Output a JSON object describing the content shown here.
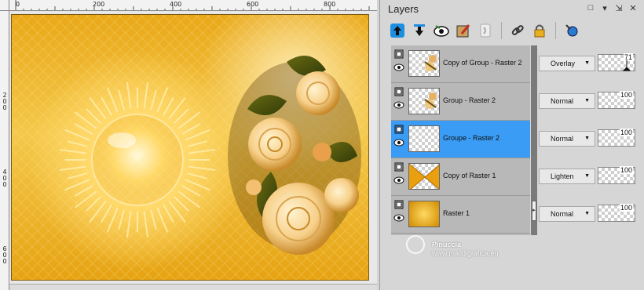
{
  "rulers": {
    "top_labels": [
      "0",
      "200",
      "400",
      "600",
      "800"
    ],
    "left_labels": [
      "2\n0\n0",
      "4\n0\n0",
      "6\n0\n0"
    ]
  },
  "palette": {
    "title": "Layers",
    "window_buttons": [
      "□",
      "▾",
      "⇲",
      "✕"
    ],
    "toolbar_icons": [
      "move-up-icon",
      "move-down-icon",
      "visibility-icon",
      "edit-icon",
      "mask-icon",
      "link-icon",
      "lock-icon",
      "brush-icon"
    ]
  },
  "layers": [
    {
      "name": "Copy of Group - Raster 2",
      "blend": "Overlay",
      "opacity": "71",
      "selected": false,
      "thumb": "flower-small"
    },
    {
      "name": "Group - Raster 2",
      "blend": "Normal",
      "opacity": "100",
      "selected": false,
      "thumb": "flower-small"
    },
    {
      "name": "Groupe - Raster 2",
      "blend": "Normal",
      "opacity": "100",
      "selected": true,
      "thumb": "white"
    },
    {
      "name": "Copy of Raster 1",
      "blend": "Lighten",
      "opacity": "100",
      "selected": false,
      "thumb": "gold-x"
    },
    {
      "name": "Raster 1",
      "blend": "Normal",
      "opacity": "100",
      "selected": false,
      "thumb": "gold"
    }
  ],
  "watermark": {
    "line1": "Pinuccia",
    "line2": "www.maildigrafica.eu"
  },
  "colors": {
    "selection": "#3a9cf5",
    "gold": "#e9a818"
  }
}
